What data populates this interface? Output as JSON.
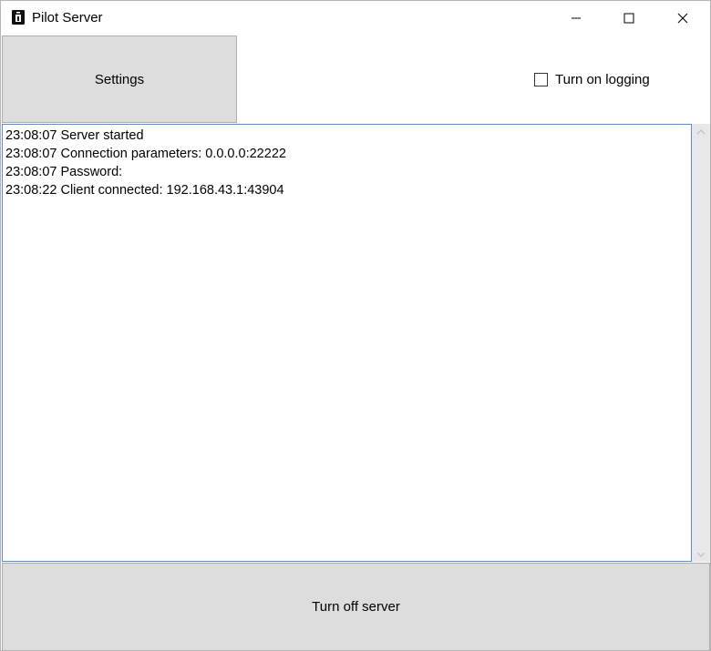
{
  "window": {
    "title": "Pilot Server"
  },
  "toolbar": {
    "settings_label": "Settings",
    "logging_label": "Turn on logging",
    "logging_checked": false
  },
  "log": {
    "lines": [
      "23:08:07 Server started",
      "23:08:07 Connection parameters: 0.0.0.0:22222",
      "23:08:07 Password:",
      "23:08:22 Client connected: 192.168.43.1:43904"
    ]
  },
  "footer": {
    "server_button_label": "Turn off server"
  },
  "colors": {
    "button_bg": "#dddddd",
    "log_border": "#5b8fc5",
    "scrollbar_bg": "#e8e8e8"
  }
}
